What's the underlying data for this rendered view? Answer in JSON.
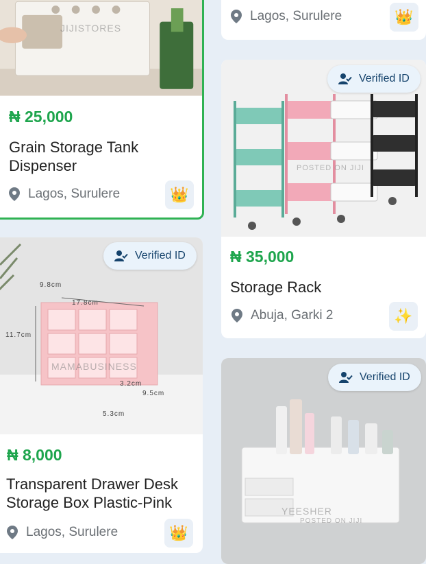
{
  "listings": [
    {
      "price": "₦ 25,000",
      "title": "Grain Storage Tank Dispenser",
      "location": "Lagos, Surulere",
      "badge_icon": "crown-icon",
      "badge_glyph": "👑",
      "watermark": "JIJISTORES"
    },
    {
      "location": "Lagos, Surulere",
      "badge_icon": "crown-icon",
      "badge_glyph": "👑"
    },
    {
      "verified": "Verified ID",
      "price": "₦ 35,000",
      "title": "Storage Rack",
      "location": "Abuja, Garki 2",
      "badge_icon": "sparkle-icon",
      "badge_glyph": "✨",
      "watermark": "POSTED ON JIJI"
    },
    {
      "verified": "Verified ID",
      "price": "₦ 8,000",
      "title": "Transparent Drawer Desk Storage Box Plastic-Pink",
      "location": "Lagos, Surulere",
      "badge_icon": "crown-icon",
      "badge_glyph": "👑",
      "watermark": "MAMABUSINESS",
      "dims": [
        "9.8cm",
        "17.8cm",
        "11.7cm",
        "3.2cm",
        "9.5cm",
        "5.3cm"
      ]
    },
    {
      "verified": "Verified ID",
      "watermark": "YEESHER",
      "watermark2": "POSTED ON JIJI"
    }
  ],
  "colors": {
    "price": "#1ea54d",
    "selected_border": "#2fb253",
    "background": "#e7eef6",
    "verified_bg": "#eaf3fb",
    "verified_text": "#15436c"
  }
}
